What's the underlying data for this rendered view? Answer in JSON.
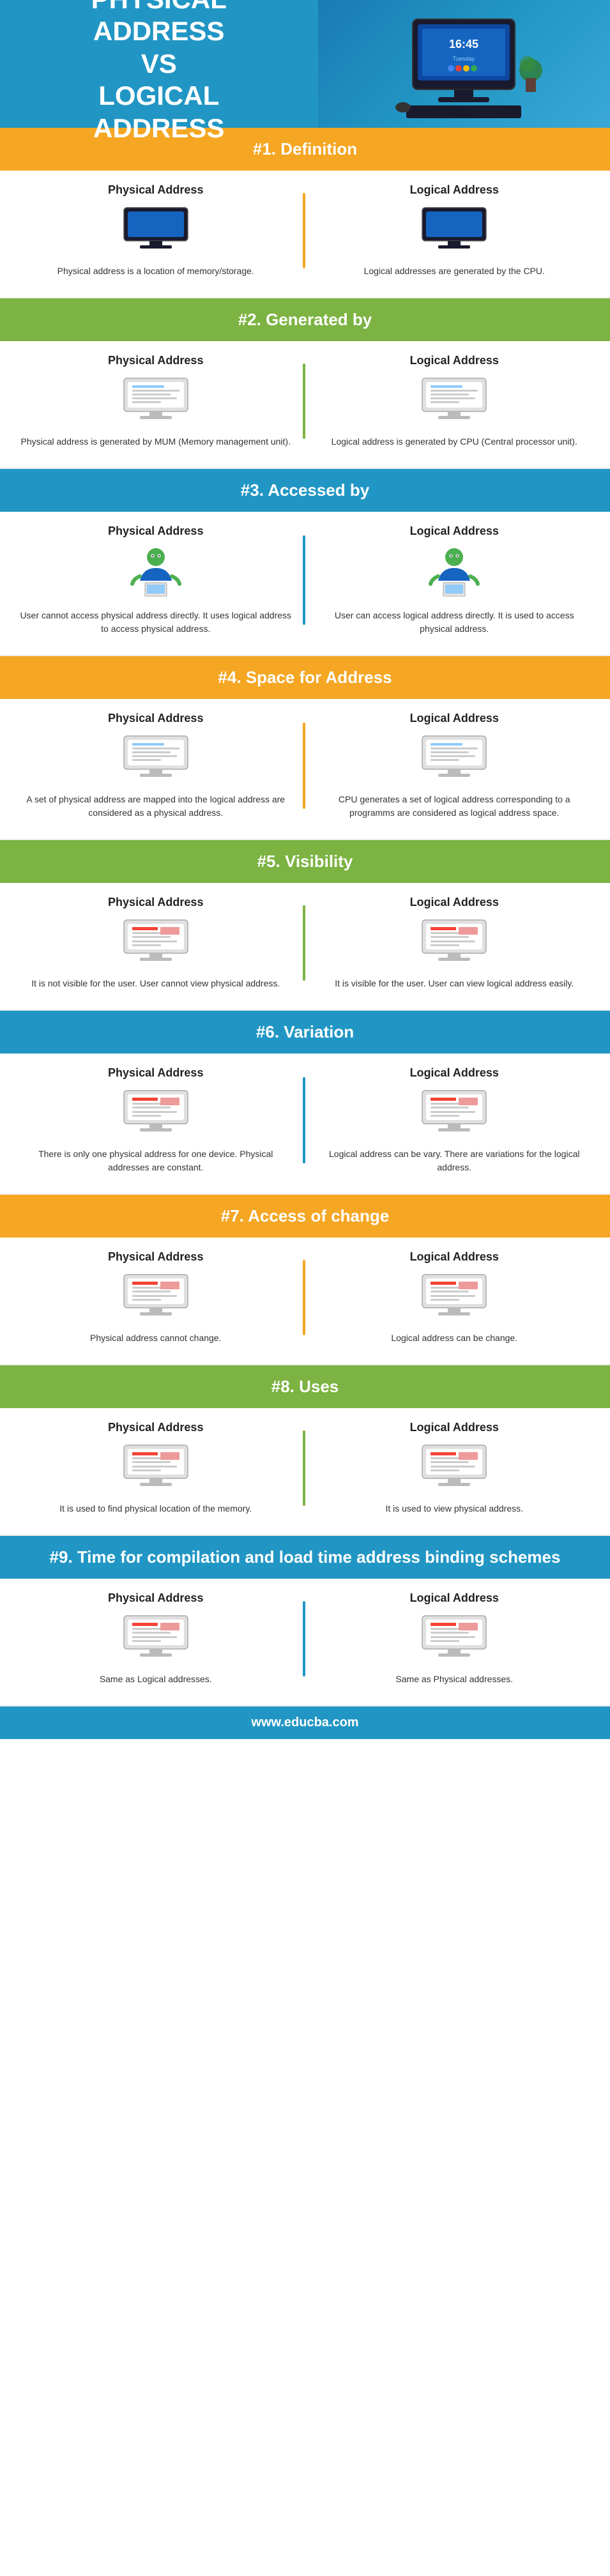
{
  "header": {
    "title_line1": "Physical",
    "title_line2": "Address",
    "title_line3": "vs",
    "title_line4": "Logical",
    "title_line5": "Address"
  },
  "sections": [
    {
      "id": "definition",
      "number": "#1.",
      "title": "Definition",
      "color": "orange",
      "physical": {
        "heading": "Physical Address",
        "icon": "monitor-basic",
        "text": "Physical address is a location of memory/storage."
      },
      "logical": {
        "heading": "Logical Address",
        "icon": "monitor-basic",
        "text": "Logical addresses are generated by the CPU."
      }
    },
    {
      "id": "generated-by",
      "number": "#2.",
      "title": "Generated by",
      "color": "green",
      "physical": {
        "heading": "Physical Address",
        "icon": "monitor-doc",
        "text": "Physical address is generated by MUM (Memory management unit)."
      },
      "logical": {
        "heading": "Logical Address",
        "icon": "monitor-doc",
        "text": "Logical address is generated by CPU (Central processor unit)."
      }
    },
    {
      "id": "accessed-by",
      "number": "#3.",
      "title": "Accessed by",
      "color": "blue",
      "physical": {
        "heading": "Physical Address",
        "icon": "person",
        "text": "User cannot access physical address directly. It uses logical address to access physical address."
      },
      "logical": {
        "heading": "Logical Address",
        "icon": "person",
        "text": "User can access logical address directly. It is used to access physical address."
      }
    },
    {
      "id": "space",
      "number": "#4.",
      "title": "Space for Address",
      "color": "orange",
      "physical": {
        "heading": "Physical Address",
        "icon": "monitor-doc",
        "text": "A set of physical address are mapped into the logical address are considered as a physical address."
      },
      "logical": {
        "heading": "Logical Address",
        "icon": "monitor-doc",
        "text": "CPU generates a set of logical address corresponding to a programms are considered as logical address space."
      }
    },
    {
      "id": "visibility",
      "number": "#5.",
      "title": "Visibility",
      "color": "green",
      "physical": {
        "heading": "Physical Address",
        "icon": "monitor-colored",
        "text": "It is not visible for the user. User cannot view physical address."
      },
      "logical": {
        "heading": "Logical Address",
        "icon": "monitor-colored",
        "text": "It is visible for the user. User can view logical address easily."
      }
    },
    {
      "id": "variation",
      "number": "#6.",
      "title": "Variation",
      "color": "blue",
      "physical": {
        "heading": "Physical Address",
        "icon": "monitor-colored",
        "text": "There is only one physical address for one device. Physical addresses are constant."
      },
      "logical": {
        "heading": "Logical Address",
        "icon": "monitor-colored",
        "text": "Logical address can be vary. There are variations for the logical address."
      }
    },
    {
      "id": "access-change",
      "number": "#7.",
      "title": "Access of change",
      "color": "orange",
      "physical": {
        "heading": "Physical Address",
        "icon": "monitor-colored",
        "text": "Physical address cannot change."
      },
      "logical": {
        "heading": "Logical Address",
        "icon": "monitor-colored",
        "text": "Logical address can be change."
      }
    },
    {
      "id": "uses",
      "number": "#8.",
      "title": "Uses",
      "color": "green",
      "physical": {
        "heading": "Physical Address",
        "icon": "monitor-colored",
        "text": "It is used to find physical location of the memory."
      },
      "logical": {
        "heading": "Logical Address",
        "icon": "monitor-colored",
        "text": "It is used to view physical address."
      }
    },
    {
      "id": "time",
      "number": "#9.",
      "title": "Time for compilation and load time address binding schemes",
      "color": "blue",
      "physical": {
        "heading": "Physical Address",
        "icon": "monitor-colored",
        "text": "Same as Logical addresses."
      },
      "logical": {
        "heading": "Logical Address",
        "icon": "monitor-colored",
        "text": "Same as Physical addresses."
      }
    }
  ],
  "footer": {
    "text": "www.educba.com"
  }
}
